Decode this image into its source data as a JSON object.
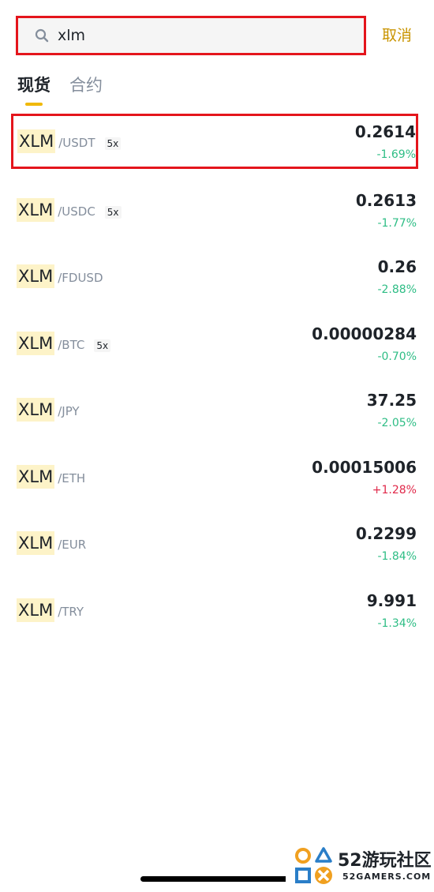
{
  "search": {
    "value": "xlm",
    "cancel_label": "取消"
  },
  "tabs": [
    {
      "label": "现货",
      "active": true
    },
    {
      "label": "合约",
      "active": false
    }
  ],
  "colors": {
    "accent": "#f0b90b",
    "cancel": "#c99400",
    "down": "#2ebd85",
    "up": "#e0294a",
    "highlight_box": "#e4151c"
  },
  "rows": [
    {
      "base": "XLM",
      "quote": "/USDT",
      "leverage": "5x",
      "price": "0.2614",
      "change": "-1.69%"
    },
    {
      "base": "XLM",
      "quote": "/USDC",
      "leverage": "5x",
      "price": "0.2613",
      "change": "-1.77%"
    },
    {
      "base": "XLM",
      "quote": "/FDUSD",
      "leverage": "",
      "price": "0.26",
      "change": "-2.88%"
    },
    {
      "base": "XLM",
      "quote": "/BTC",
      "leverage": "5x",
      "price": "0.00000284",
      "change": "-0.70%"
    },
    {
      "base": "XLM",
      "quote": "/JPY",
      "leverage": "",
      "price": "37.25",
      "change": "-2.05%"
    },
    {
      "base": "XLM",
      "quote": "/ETH",
      "leverage": "",
      "price": "0.00015006",
      "change": "+1.28%"
    },
    {
      "base": "XLM",
      "quote": "/EUR",
      "leverage": "",
      "price": "0.2299",
      "change": "-1.84%"
    },
    {
      "base": "XLM",
      "quote": "/TRY",
      "leverage": "",
      "price": "9.991",
      "change": "-1.34%"
    }
  ],
  "watermark": {
    "title": "52游玩社区",
    "subtitle": "52GAMERS.COM"
  }
}
